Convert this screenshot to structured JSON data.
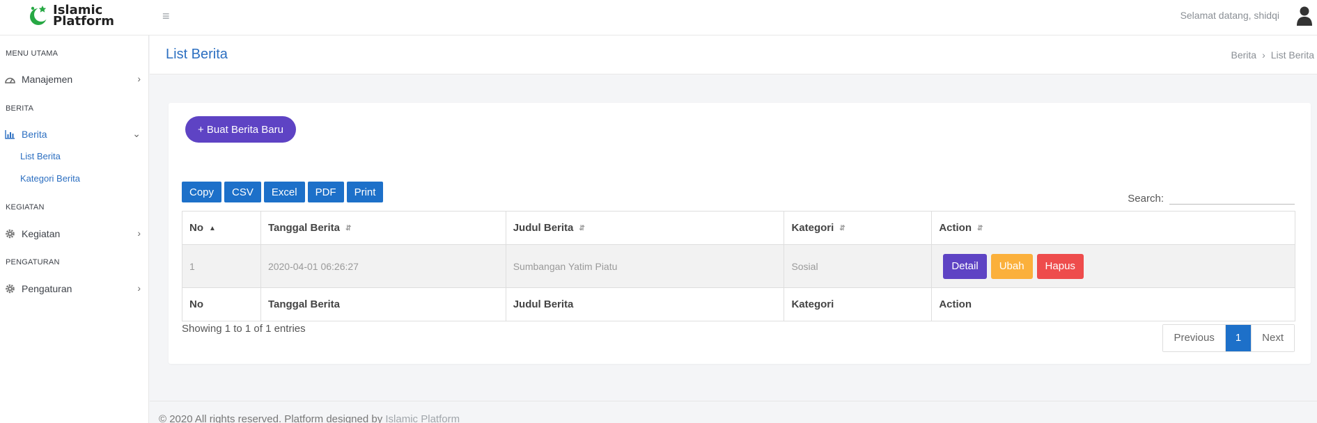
{
  "brand": {
    "name_line1": "Islamic",
    "name_line2": "Platform",
    "logo_icon": "crescent-moon-icon"
  },
  "topbar": {
    "welcome": "Selamat datang, shidqi",
    "menu_icon": "hamburger-icon",
    "user_icon": "user-avatar-icon"
  },
  "sidebar": {
    "sections": [
      {
        "title": "MENU UTAMA"
      },
      {
        "title": "BERITA"
      },
      {
        "title": "KEGIATAN"
      },
      {
        "title": "PENGATURAN"
      }
    ],
    "items": [
      {
        "label": "Manajemen",
        "icon": "dashboard-icon"
      },
      {
        "label": "Berita",
        "icon": "bar-chart-icon"
      },
      {
        "label": "Kegiatan",
        "icon": "gear-icon"
      },
      {
        "label": "Pengaturan",
        "icon": "gear-icon"
      }
    ],
    "sub_items": [
      "List Berita",
      "Kategori Berita"
    ]
  },
  "page": {
    "title": "List Berita",
    "breadcrumb": [
      "Berita",
      "List Berita"
    ]
  },
  "card": {
    "new_button": "+ Buat Berita Baru",
    "export_buttons": [
      "Copy",
      "CSV",
      "Excel",
      "PDF",
      "Print"
    ],
    "search": {
      "label": "Search:",
      "value": ""
    }
  },
  "table": {
    "columns": [
      "No",
      "Tanggal Berita",
      "Judul Berita",
      "Kategori",
      "Action"
    ],
    "rows": [
      {
        "no": "1",
        "tanggal": "2020-04-01 06:26:27",
        "judul": "Sumbangan Yatim Piatu",
        "kategori": "Sosial"
      }
    ],
    "row_actions": [
      "Detail",
      "Ubah",
      "Hapus"
    ],
    "colors": {
      "detail": "#5e43c4",
      "ubah": "#fbb03b",
      "hapus": "#ee4c4c",
      "primary": "#1d70c9"
    }
  },
  "pagination": {
    "info": "Showing 1 to 1 of 1 entries",
    "previous": "Previous",
    "current": "1",
    "next": "Next"
  },
  "footer": {
    "text": "© 2020 All rights reserved. Platform designed by ",
    "link": "Islamic Platform"
  }
}
